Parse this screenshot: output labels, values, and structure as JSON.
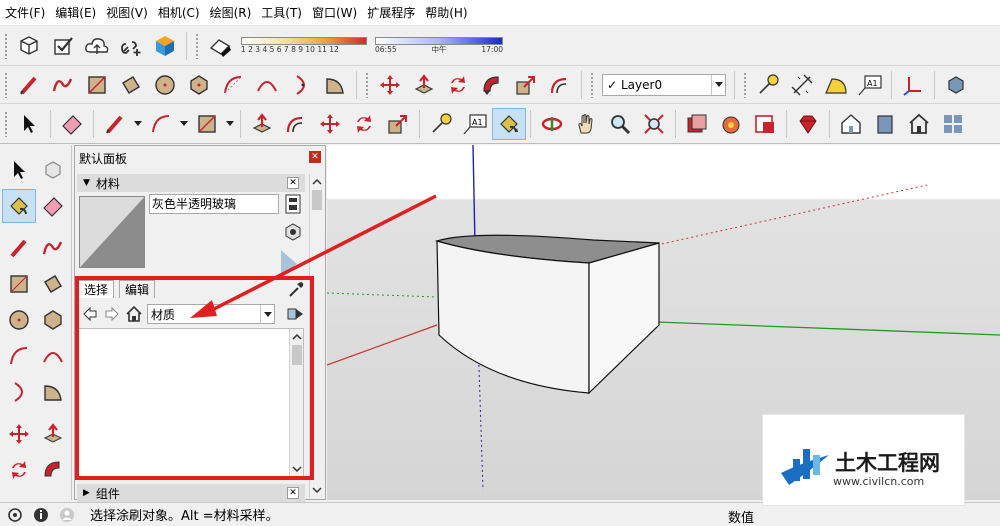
{
  "menu": [
    "文件(F)",
    "编辑(E)",
    "视图(V)",
    "相机(C)",
    "绘图(R)",
    "工具(T)",
    "窗口(W)",
    "扩展程序",
    "帮助(H)"
  ],
  "shadow": {
    "months": "1 2 3 4 5 6 7 8 9 10 11 12",
    "time_start": "06:55",
    "time_mid": "中午",
    "time_end": "17:00"
  },
  "layer": {
    "name": "Layer0"
  },
  "tray": {
    "title": "默认面板",
    "materials_section": "材料",
    "material_name": "灰色半透明玻璃",
    "tab_select": "选择",
    "tab_edit": "编辑",
    "collection": "材质",
    "components_section": "组件"
  },
  "status": {
    "message": "选择涂刷对象。Alt =材料采样。",
    "value_label": "数值"
  },
  "watermark": {
    "main": "土木工程网",
    "url": "www.civilcn.com"
  },
  "colors": {
    "highlight": "#e02020",
    "axis_red": "#c83232",
    "axis_green": "#1e9b1e",
    "axis_blue": "#2020b4",
    "accent": "#c7e0f4"
  }
}
